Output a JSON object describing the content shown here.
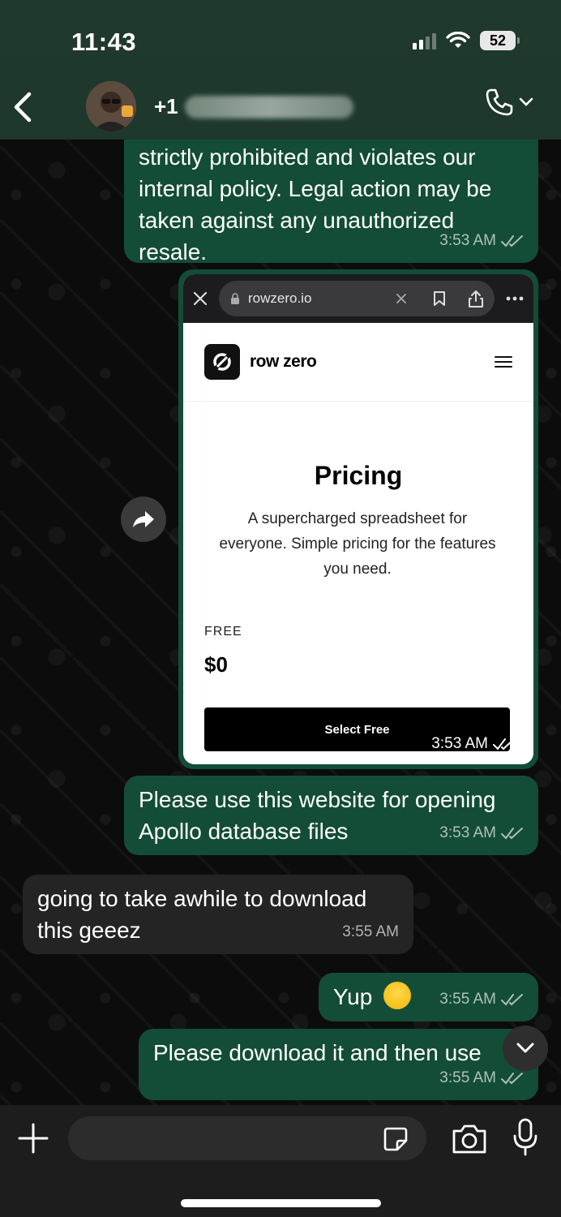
{
  "status_bar": {
    "time": "11:43",
    "battery": "52"
  },
  "header": {
    "contact_prefix": "+1"
  },
  "messages": [
    {
      "direction": "out",
      "lines": [
        "strictly prohibited and violates our",
        "internal policy. Legal action may be",
        "taken against any unauthorized",
        "resale."
      ],
      "time": "3:53 AM"
    },
    {
      "direction": "out",
      "type": "image",
      "time": "3:53 AM",
      "screenshot": {
        "url": "rowzero.io",
        "logo_text": "row zero",
        "heading": "Pricing",
        "subtext": "A supercharged spreadsheet for everyone. Simple pricing for the features you need.",
        "plan_name": "FREE",
        "plan_price": "$0",
        "button_label": "Select Free"
      }
    },
    {
      "direction": "out",
      "lines": [
        "Please use this website for opening",
        "Apollo database files"
      ],
      "time": "3:53 AM"
    },
    {
      "direction": "in",
      "lines": [
        "going to take awhile to download",
        "this geeez"
      ],
      "time": "3:55 AM"
    },
    {
      "direction": "out",
      "text": "Yup",
      "emoji": "grinning-sweat-emoji",
      "time": "3:55 AM"
    },
    {
      "direction": "out",
      "text": "Please download it and then use",
      "time": "3:55 AM"
    }
  ],
  "input": {
    "placeholder": ""
  },
  "colors": {
    "header_bg": "#1e382b",
    "outgoing_bubble": "#134d37",
    "incoming_bubble": "#242424",
    "input_bar_bg": "#1d1d1d"
  },
  "icons": [
    "back-chevron-icon",
    "phone-icon",
    "chevron-down-icon",
    "forward-icon",
    "plus-icon",
    "sticker-icon",
    "camera-icon",
    "microphone-icon",
    "read-receipt-icon"
  ]
}
